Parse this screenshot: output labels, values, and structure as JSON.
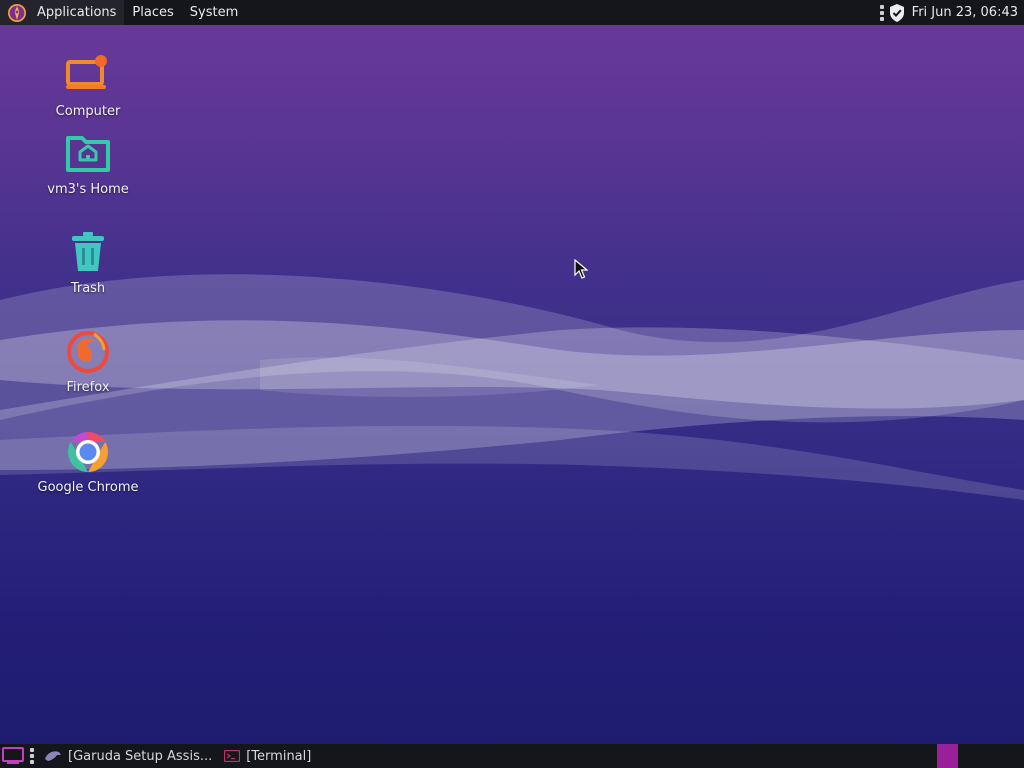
{
  "top_panel": {
    "menus": [
      "Applications",
      "Places",
      "System"
    ],
    "clock": "Fri Jun 23, 06:43",
    "icons": [
      "garuda-logo-icon",
      "dots-icon",
      "shield-check-icon"
    ]
  },
  "desktop": {
    "icons": [
      {
        "label": "Computer",
        "icon": "computer-icon"
      },
      {
        "label": "vm3's Home",
        "icon": "home-folder-icon"
      },
      {
        "label": "Trash",
        "icon": "trash-icon"
      },
      {
        "label": "Firefox",
        "icon": "firefox-icon"
      },
      {
        "label": "Google Chrome",
        "icon": "chrome-icon"
      }
    ]
  },
  "bottom_panel": {
    "tasks": [
      {
        "label": "[Garuda Setup Assis...",
        "icon": "garuda-bird-icon"
      },
      {
        "label": "[Terminal]",
        "icon": "terminal-icon"
      }
    ],
    "colors": {
      "workspace_active": "#9a1f9a"
    }
  }
}
